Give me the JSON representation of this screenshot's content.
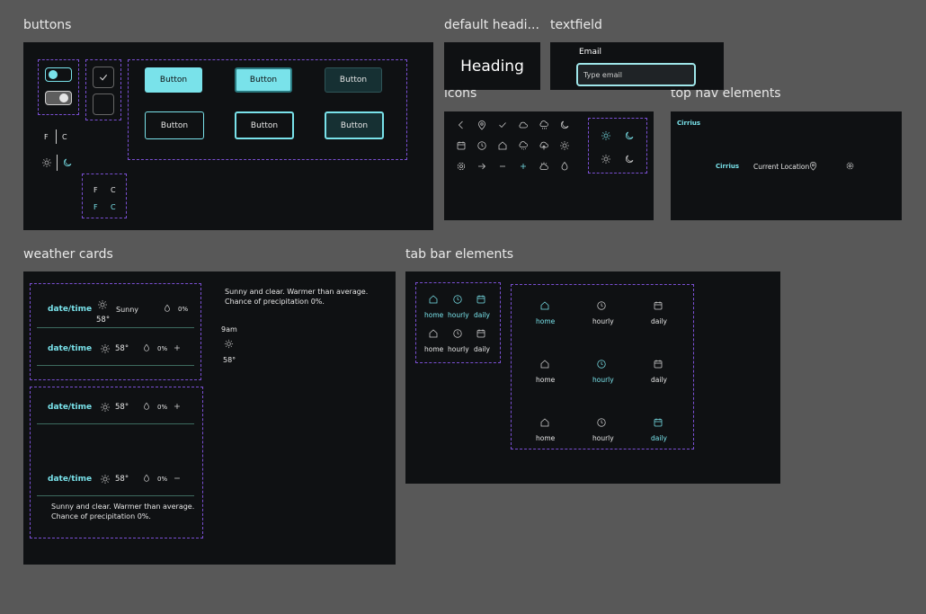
{
  "colors": {
    "accent": "#79e2ea",
    "panel": "#0f1113",
    "canvas": "#585858",
    "dashed": "#7a4fd3"
  },
  "sections": {
    "buttons": "buttons",
    "heading": "default headi...",
    "textfield": "textfield",
    "icons": "icons",
    "topnav": "top nav elements",
    "weather": "weather cards",
    "tabbar": "tab bar elements"
  },
  "buttons": {
    "label": "Button",
    "unit_f": "F",
    "unit_c": "C"
  },
  "heading": {
    "text": "Heading"
  },
  "textfield": {
    "label": "Email",
    "placeholder": "Type email"
  },
  "topnav": {
    "brand": "Cirrius",
    "brand_small": "Cirrius",
    "location": "Current Location"
  },
  "weather": {
    "datetime": "date/time",
    "condition": "Sunny",
    "temp": "58°",
    "precip": "0%",
    "description": "Sunny and clear. Warmer than average. Chance of precipitation 0%.",
    "hour": "9am"
  },
  "tabbar": {
    "home": "home",
    "hourly": "hourly",
    "daily": "daily"
  },
  "icons": [
    "chevron-left-icon",
    "pin-icon",
    "check-icon",
    "cloud-icon",
    "cloud-rain-icon",
    "moon-icon",
    "calendar-icon",
    "clock-icon",
    "home-icon",
    "cloud-snow-icon",
    "cloud-upload-icon",
    "sun-icon",
    "gear-icon",
    "arrow-right-icon",
    "minus-icon",
    "plus-icon",
    "sunrise-icon",
    "drop-icon"
  ]
}
